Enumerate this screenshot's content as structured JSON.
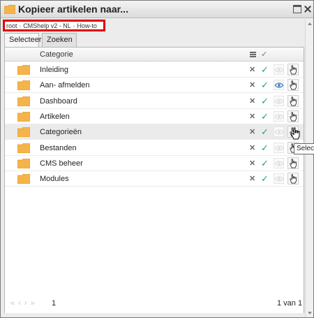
{
  "window": {
    "title": "Kopieer artikelen naar..."
  },
  "breadcrumb": [
    "root",
    "CMShelp v2 - NL",
    "How-to"
  ],
  "tabs": [
    {
      "label": "Selecteer",
      "active": true
    },
    {
      "label": "Zoeken",
      "active": false
    }
  ],
  "grid": {
    "header": {
      "category_label": "Categorie",
      "menu_icon": "menu-lines-icon",
      "check_icon": "checkmark-icon"
    },
    "rows": [
      {
        "label": "Inleiding",
        "visibility": "inactive",
        "hover": false
      },
      {
        "label": "Aan- afmelden",
        "visibility": "active",
        "hover": false
      },
      {
        "label": "Dashboard",
        "visibility": "inactive",
        "hover": false
      },
      {
        "label": "Artikelen",
        "visibility": "inactive",
        "hover": false
      },
      {
        "label": "Categorieën",
        "visibility": "inactive",
        "hover": true
      },
      {
        "label": "Bestanden",
        "visibility": "inactive",
        "hover": false
      },
      {
        "label": "CMS beheer",
        "visibility": "inactive",
        "hover": false
      },
      {
        "label": "Modules",
        "visibility": "inactive",
        "hover": false
      }
    ]
  },
  "tooltip": {
    "text": "Selecteer"
  },
  "pager": {
    "arrows": "«‹›»",
    "current_page": "1",
    "count_text": "1 van 1"
  },
  "colors": {
    "folder": "#f5b44a",
    "check": "#1aa85a",
    "eye_active": "#2a78c8",
    "highlight": "#e00000"
  }
}
